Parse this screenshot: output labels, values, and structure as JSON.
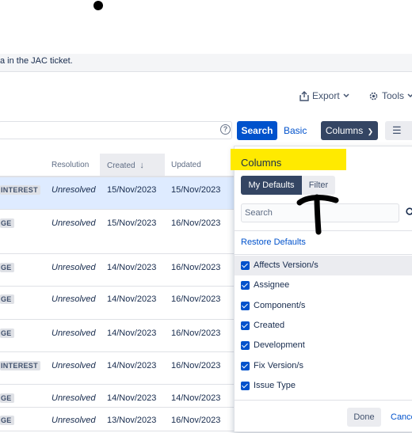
{
  "note": {
    "text": "a in the JAC ticket."
  },
  "toolbar": {
    "export_label": "Export",
    "tools_label": "Tools"
  },
  "search": {
    "help_glyph": "?",
    "search_button": "Search",
    "basic_link": "Basic",
    "columns_button": "Columns"
  },
  "table": {
    "headers": {
      "resolution": "Resolution",
      "created": "Created",
      "updated": "Updated"
    },
    "rows": [
      {
        "badge": "INTEREST",
        "resolution": "Unresolved",
        "created": "15/Nov/2023",
        "updated": "15/Nov/2023",
        "selected": true
      },
      {
        "badge": "GE",
        "resolution": "Unresolved",
        "created": "15/Nov/2023",
        "updated": "16/Nov/2023"
      },
      {
        "badge": "GE",
        "resolution": "Unresolved",
        "created": "14/Nov/2023",
        "updated": "16/Nov/2023"
      },
      {
        "badge": "GE",
        "resolution": "Unresolved",
        "created": "14/Nov/2023",
        "updated": "16/Nov/2023"
      },
      {
        "badge": "GE",
        "resolution": "Unresolved",
        "created": "14/Nov/2023",
        "updated": "16/Nov/2023"
      },
      {
        "badge": "INTEREST",
        "resolution": "Unresolved",
        "created": "14/Nov/2023",
        "updated": "16/Nov/2023"
      },
      {
        "badge": "GE",
        "resolution": "Unresolved",
        "created": "14/Nov/2023",
        "updated": "14/Nov/2023"
      },
      {
        "badge": "GE",
        "resolution": "Unresolved",
        "created": "13/Nov/2023",
        "updated": "16/Nov/2023"
      }
    ]
  },
  "columns_panel": {
    "title": "Columns",
    "tabs": {
      "my_defaults": "My Defaults",
      "filter": "Filter"
    },
    "search_placeholder": "Search",
    "restore_defaults": "Restore Defaults",
    "options": [
      "Affects Version/s",
      "Assignee",
      "Component/s",
      "Created",
      "Development",
      "Fix Version/s",
      "Issue Type"
    ],
    "done_button": "Done",
    "cancel_link": "Cance"
  },
  "colors": {
    "primary": "#0052cc",
    "dark": "#344563",
    "highlight": "#ffea00",
    "selected_row": "#deebff"
  }
}
